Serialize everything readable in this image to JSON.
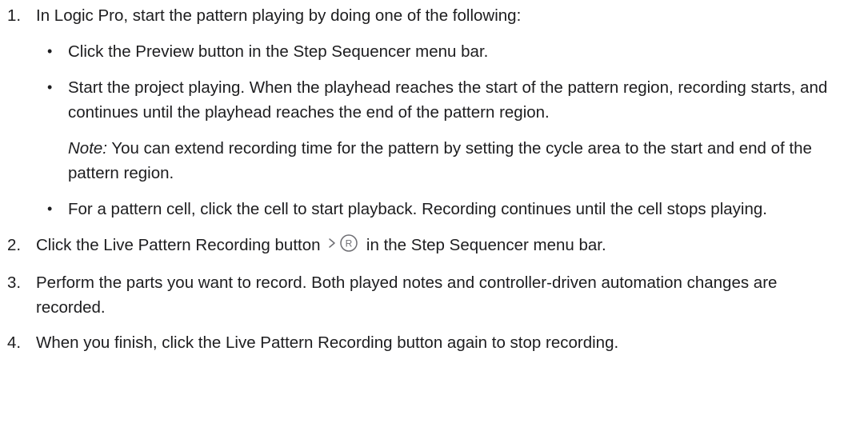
{
  "steps": [
    {
      "number": "1.",
      "text": "In Logic Pro, start the pattern playing by doing one of the following:",
      "bullets": [
        {
          "text": "Click the Preview button in the Step Sequencer menu bar."
        },
        {
          "text": "Start the project playing. When the playhead reaches the start of the pattern region, recording starts, and continues until the playhead reaches the end of the pattern region.",
          "note_label": "Note:",
          "note_text": " You can extend recording time for the pattern by setting the cycle area to the start and end of the pattern region."
        },
        {
          "text": "For a pattern cell, click the cell to start playback. Recording continues until the cell stops playing."
        }
      ]
    },
    {
      "number": "2.",
      "text_before": "Click the Live Pattern Recording button ",
      "icon": "record-icon",
      "icon_glyph": "R",
      "text_after": " in the Step Sequencer menu bar."
    },
    {
      "number": "3.",
      "text": "Perform the parts you want to record. Both played notes and controller-driven automation changes are recorded."
    },
    {
      "number": "4.",
      "text": "When you finish, click the Live Pattern Recording button again to stop recording."
    }
  ],
  "bullet_char": "•",
  "colors": {
    "text": "#1d1d1f",
    "background": "#ffffff"
  }
}
